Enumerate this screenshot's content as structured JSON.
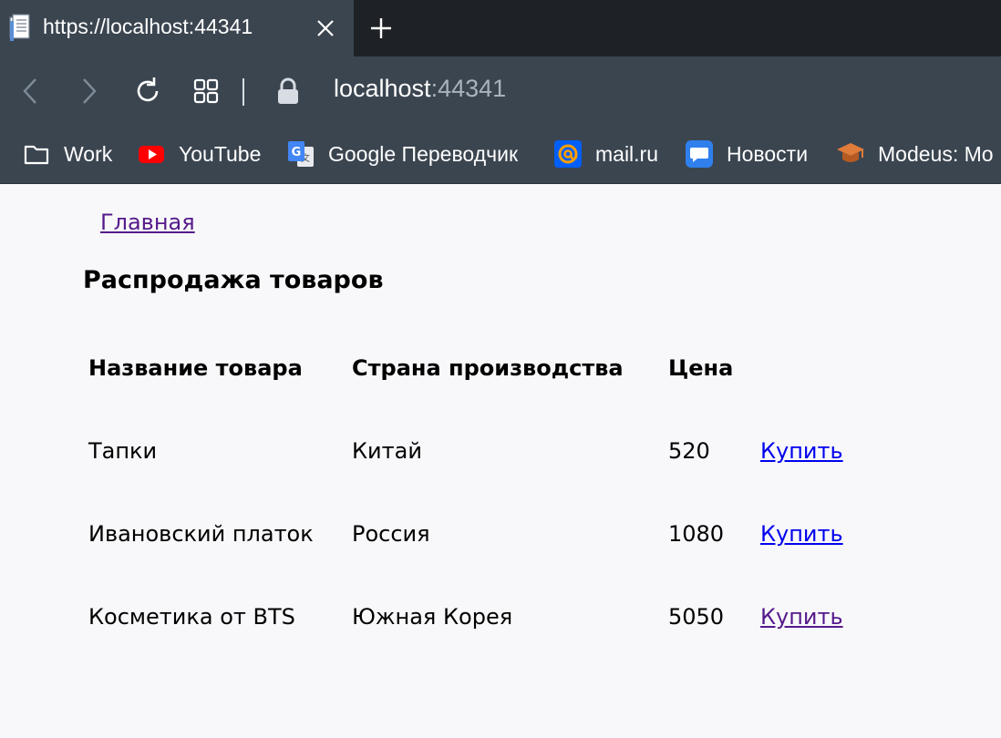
{
  "browser": {
    "tab_title": "https://localhost:44341",
    "url_host": "localhost",
    "url_port": ":44341",
    "bookmarks": [
      {
        "label": "Work",
        "icon": "folder-icon"
      },
      {
        "label": "YouTube",
        "icon": "youtube-icon"
      },
      {
        "label": "Google Переводчик",
        "icon": "google-translate-icon"
      },
      {
        "label": "mail.ru",
        "icon": "mailru-icon"
      },
      {
        "label": "Новости",
        "icon": "news-chat-icon"
      },
      {
        "label": "Modeus: Mo",
        "icon": "graduation-cap-icon"
      }
    ]
  },
  "page": {
    "home_link": "Главная",
    "title": "Распродажа товаров",
    "table": {
      "headers": [
        "Название товара",
        "Страна производства",
        "Цена"
      ],
      "rows": [
        {
          "name": "Тапки",
          "country": "Китай",
          "price": "520",
          "action": "Купить",
          "visited": false
        },
        {
          "name": "Ивановский платок",
          "country": "Россия",
          "price": "1080",
          "action": "Купить",
          "visited": false
        },
        {
          "name": "Косметика от BTS",
          "country": "Южная Корея",
          "price": "5050",
          "action": "Купить",
          "visited": true
        }
      ]
    }
  },
  "colors": {
    "link": "#0000ee",
    "visited_link": "#551a8b",
    "chrome_bg": "#3b4550",
    "tabstrip_bg": "#1e2227",
    "page_bg": "#f8f8fa"
  }
}
